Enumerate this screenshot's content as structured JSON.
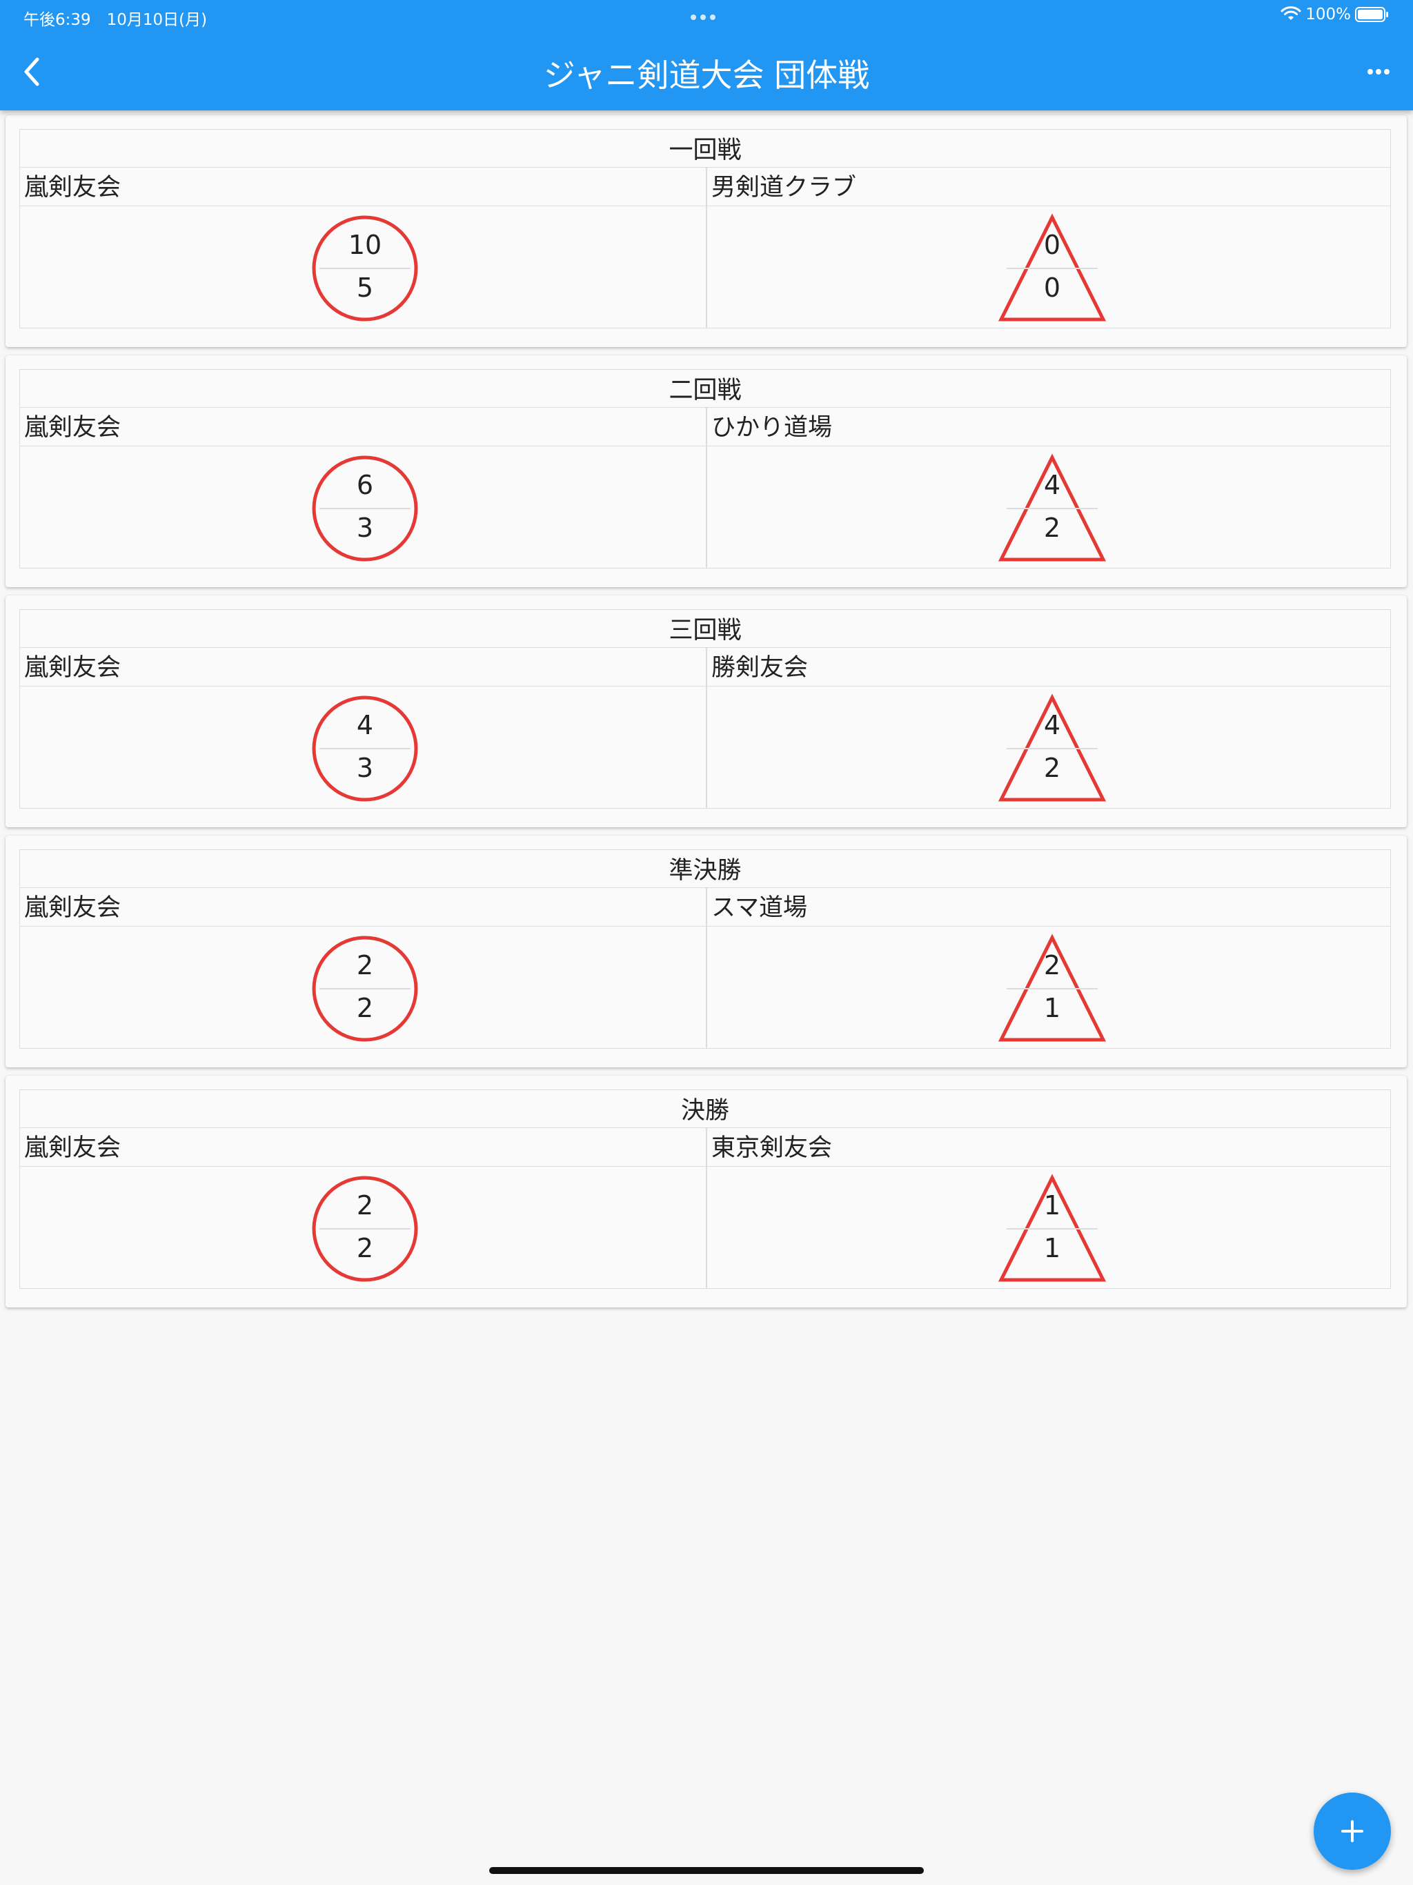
{
  "status_bar": {
    "time": "午後6:39　10月10日(月)",
    "battery": "100%"
  },
  "app_bar": {
    "title": "ジャニ剣道大会 団体戦",
    "back_icon": "chevron-left-icon",
    "more_icon": "more-horizontal-icon"
  },
  "colors": {
    "app_bar": "#2196f3",
    "mark": "#e53935",
    "fab": "#2196f3"
  },
  "matches": [
    {
      "round": "一回戦",
      "left_team": "嵐剣友会",
      "right_team": "男剣道クラブ",
      "left_mark": "circle",
      "left_scores": [
        "10",
        "5"
      ],
      "right_mark": "triangle",
      "right_scores": [
        "0",
        "0"
      ]
    },
    {
      "round": "二回戦",
      "left_team": "嵐剣友会",
      "right_team": "ひかり道場",
      "left_mark": "circle",
      "left_scores": [
        "6",
        "3"
      ],
      "right_mark": "triangle",
      "right_scores": [
        "4",
        "2"
      ]
    },
    {
      "round": "三回戦",
      "left_team": "嵐剣友会",
      "right_team": "勝剣友会",
      "left_mark": "circle",
      "left_scores": [
        "4",
        "3"
      ],
      "right_mark": "triangle",
      "right_scores": [
        "4",
        "2"
      ]
    },
    {
      "round": "準決勝",
      "left_team": "嵐剣友会",
      "right_team": "スマ道場",
      "left_mark": "circle",
      "left_scores": [
        "2",
        "2"
      ],
      "right_mark": "triangle",
      "right_scores": [
        "2",
        "1"
      ]
    },
    {
      "round": "決勝",
      "left_team": "嵐剣友会",
      "right_team": "東京剣友会",
      "left_mark": "circle",
      "left_scores": [
        "2",
        "2"
      ],
      "right_mark": "triangle",
      "right_scores": [
        "1",
        "1"
      ]
    }
  ],
  "fab": {
    "icon": "plus-icon"
  }
}
